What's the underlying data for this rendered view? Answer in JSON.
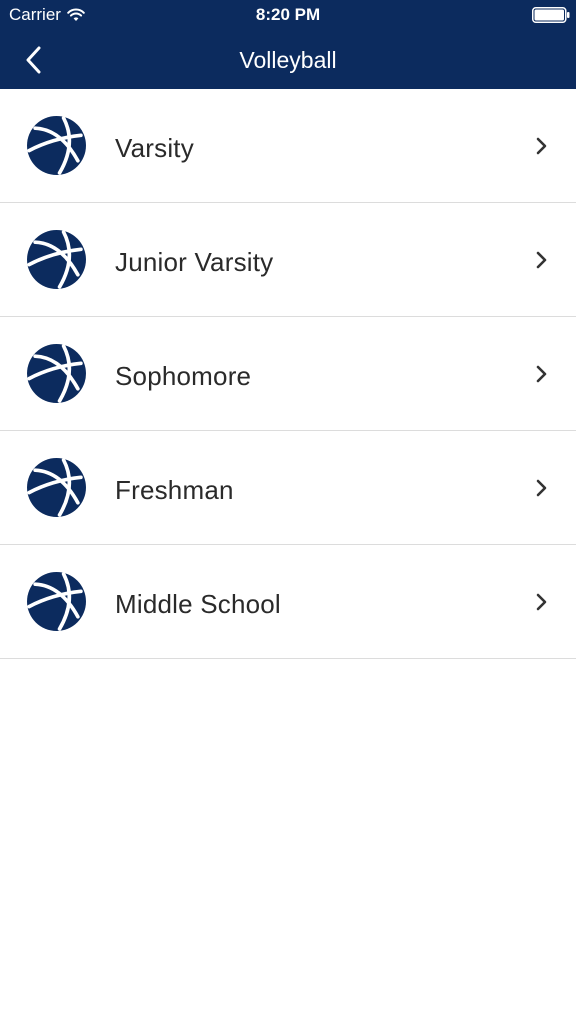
{
  "status_bar": {
    "carrier": "Carrier",
    "time": "8:20 PM",
    "wifi_icon": "wifi-icon",
    "battery_icon": "battery-icon"
  },
  "nav": {
    "title": "Volleyball",
    "back_icon": "chevron-left-icon"
  },
  "list": {
    "items": [
      {
        "label": "Varsity",
        "icon": "ball-icon"
      },
      {
        "label": "Junior Varsity",
        "icon": "ball-icon"
      },
      {
        "label": "Sophomore",
        "icon": "ball-icon"
      },
      {
        "label": "Freshman",
        "icon": "ball-icon"
      },
      {
        "label": "Middle School",
        "icon": "ball-icon"
      }
    ]
  },
  "colors": {
    "brand_navy": "#0c2b5e",
    "text": "#2a2a2a",
    "divider": "#dcdcdc",
    "background": "#ffffff"
  }
}
